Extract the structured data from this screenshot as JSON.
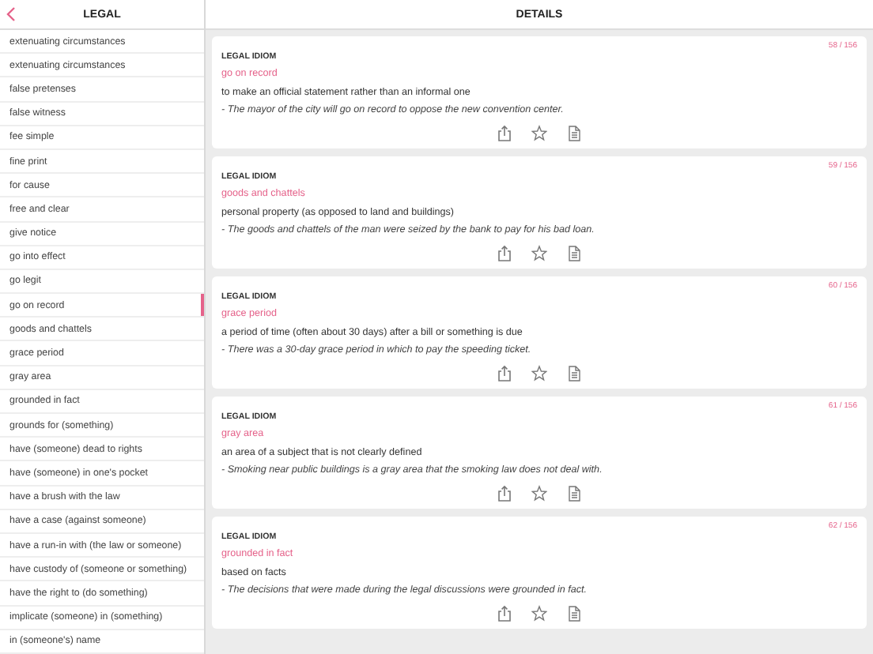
{
  "sidebar": {
    "title": "LEGAL",
    "items": [
      {
        "label": "extenuating circumstances",
        "selected": false
      },
      {
        "label": "extenuating circumstances",
        "selected": false
      },
      {
        "label": "false pretenses",
        "selected": false
      },
      {
        "label": "false witness",
        "selected": false
      },
      {
        "label": "fee simple",
        "selected": false
      },
      {
        "label": "fine print",
        "selected": false
      },
      {
        "label": "for cause",
        "selected": false
      },
      {
        "label": "free and clear",
        "selected": false
      },
      {
        "label": "give notice",
        "selected": false
      },
      {
        "label": "go into effect",
        "selected": false
      },
      {
        "label": "go legit",
        "selected": false
      },
      {
        "label": "go on record",
        "selected": true
      },
      {
        "label": "goods and chattels",
        "selected": false
      },
      {
        "label": "grace period",
        "selected": false
      },
      {
        "label": "gray area",
        "selected": false
      },
      {
        "label": "grounded in fact",
        "selected": false
      },
      {
        "label": "grounds for (something)",
        "selected": false
      },
      {
        "label": "have (someone) dead to rights",
        "selected": false
      },
      {
        "label": "have (someone) in one's pocket",
        "selected": false
      },
      {
        "label": "have a brush with the law",
        "selected": false
      },
      {
        "label": "have a case (against someone)",
        "selected": false
      },
      {
        "label": "have a run-in with (the law or someone)",
        "selected": false
      },
      {
        "label": "have custody of (someone or something)",
        "selected": false
      },
      {
        "label": "have the right to (do something)",
        "selected": false
      },
      {
        "label": "implicate (someone) in (something)",
        "selected": false
      },
      {
        "label": "in (someone's) name",
        "selected": false
      }
    ]
  },
  "details": {
    "title": "DETAILS",
    "cards": [
      {
        "counter": "58 / 156",
        "category": "LEGAL IDIOM",
        "term": "go on record",
        "definition": "to make an official statement rather than an informal one",
        "example": "- The mayor of the city will go on record to oppose the new convention center."
      },
      {
        "counter": "59 / 156",
        "category": "LEGAL IDIOM",
        "term": "goods and chattels",
        "definition": "personal property (as opposed to land and buildings)",
        "example": "- The goods and chattels of the man were seized by the bank to pay for his bad loan."
      },
      {
        "counter": "60 / 156",
        "category": "LEGAL IDIOM",
        "term": "grace period",
        "definition": "a period of time (often about 30 days) after a bill or something is due",
        "example": "- There was a 30-day grace period in which to pay the speeding ticket."
      },
      {
        "counter": "61 / 156",
        "category": "LEGAL IDIOM",
        "term": "gray area",
        "definition": "an area of a subject that is not clearly defined",
        "example": "- Smoking near public buildings is a gray area that the smoking law does not deal with."
      },
      {
        "counter": "62 / 156",
        "category": "LEGAL IDIOM",
        "term": "grounded in fact",
        "definition": "based on facts",
        "example": "- The decisions that were made during the legal discussions were grounded in fact."
      }
    ]
  }
}
